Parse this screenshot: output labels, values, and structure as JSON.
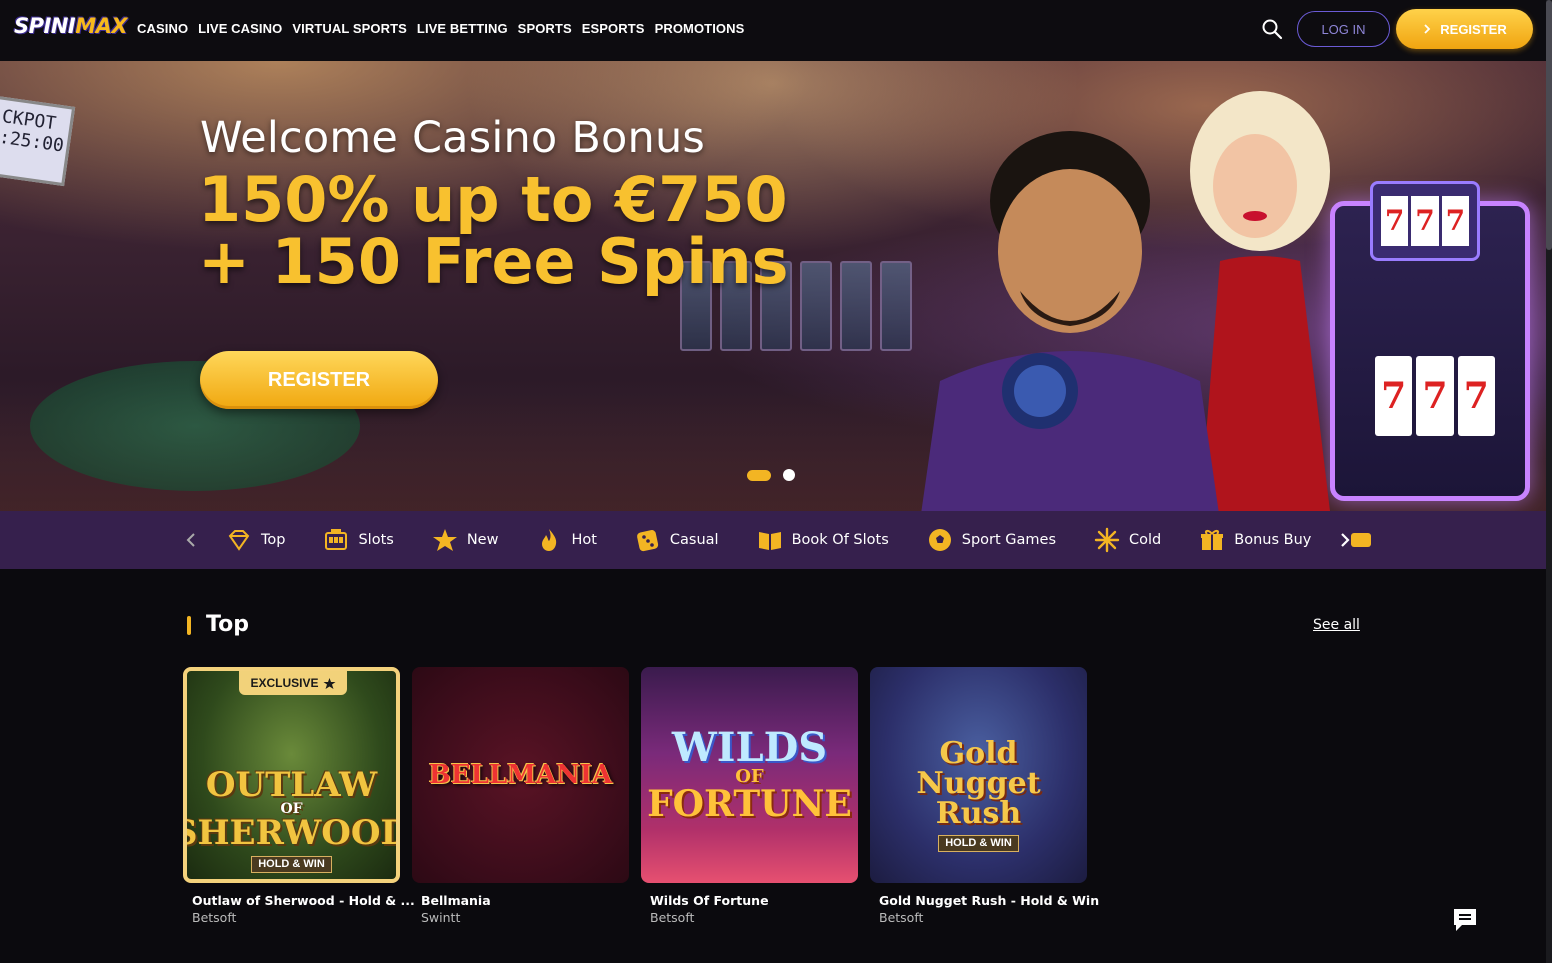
{
  "header": {
    "logo_text_1": "SPINI",
    "logo_text_2": "MAX",
    "nav": [
      "CASINO",
      "LIVE CASINO",
      "VIRTUAL SPORTS",
      "LIVE BETTING",
      "SPORTS",
      "ESPORTS",
      "PROMOTIONS"
    ],
    "login_label": "LOG IN",
    "register_label": "REGISTER",
    "search_icon": "search-icon"
  },
  "hero": {
    "title": "Welcome Casino Bonus",
    "offer_line1": "150% up to €750",
    "offer_line2": "+ 150 Free Spins",
    "cta_label": "REGISTER",
    "jackpot_text": "CKPOT :25:00",
    "slide_count": 2,
    "active_slide": 1
  },
  "categories": {
    "items": [
      {
        "label": "Top",
        "icon": "diamond-icon"
      },
      {
        "label": "Slots",
        "icon": "slot-machine-icon"
      },
      {
        "label": "New",
        "icon": "star-icon"
      },
      {
        "label": "Hot",
        "icon": "flame-icon"
      },
      {
        "label": "Casual",
        "icon": "dice-icon"
      },
      {
        "label": "Book Of Slots",
        "icon": "book-icon"
      },
      {
        "label": "Sport Games",
        "icon": "ball-icon"
      },
      {
        "label": "Cold",
        "icon": "snowflake-icon"
      },
      {
        "label": "Bonus Buy",
        "icon": "gift-icon"
      }
    ]
  },
  "section": {
    "title": "Top",
    "see_all": "See all"
  },
  "games": [
    {
      "name": "Outlaw of Sherwood - Hold & ...",
      "provider": "Betsoft",
      "badge": "EXCLUSIVE",
      "art_line1": "OUTLAW",
      "art_line2": "OF",
      "art_line3": "SHERWOOD",
      "art_sub": "HOLD & WIN"
    },
    {
      "name": "Bellmania",
      "provider": "Swintt",
      "art_line1": "BELLMANIA"
    },
    {
      "name": "Wilds Of Fortune",
      "provider": "Betsoft",
      "art_line1": "WILDS",
      "art_line2": "OF",
      "art_line3": "FORTUNE"
    },
    {
      "name": "Gold Nugget Rush - Hold & Win",
      "provider": "Betsoft",
      "art_line1": "Gold",
      "art_line2": "Nugget",
      "art_line3": "Rush",
      "art_sub": "HOLD & WIN"
    }
  ],
  "colors": {
    "accent": "#f3b523",
    "category_bar": "#36204d",
    "login_border": "#6b5bd6"
  }
}
